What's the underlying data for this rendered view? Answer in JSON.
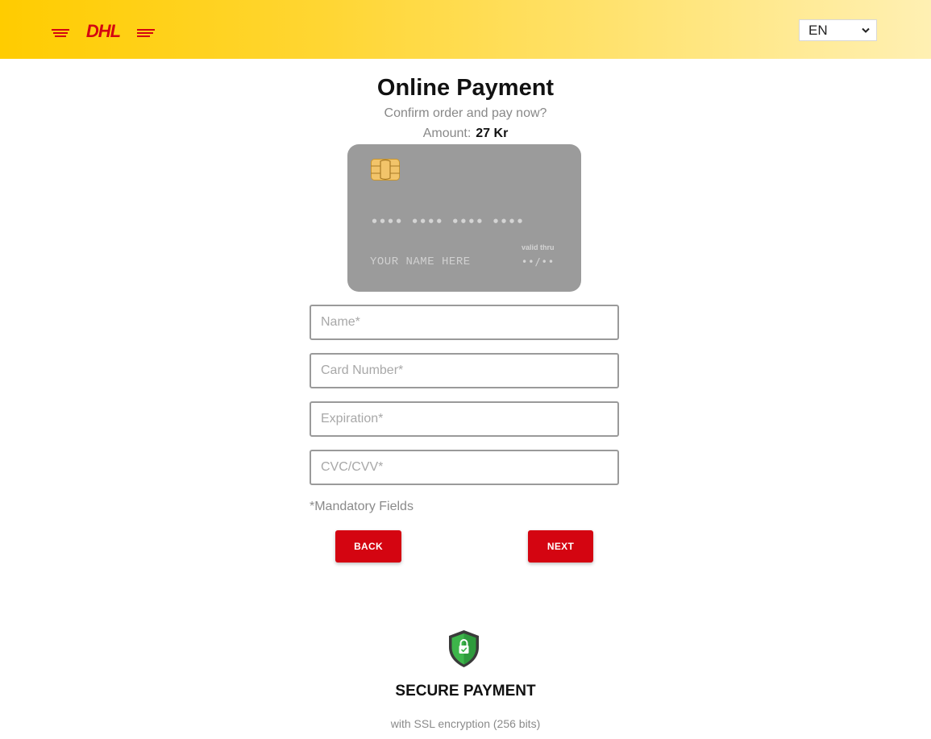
{
  "header": {
    "logo_text": "DHL",
    "language": {
      "selected": "EN"
    }
  },
  "main": {
    "title": "Online Payment",
    "subtitle": "Confirm order and pay now?",
    "amount_label": "Amount:",
    "amount_value": "27 Kr"
  },
  "card_preview": {
    "number_mask": "•••• •••• •••• ••••",
    "name_placeholder": "YOUR NAME HERE",
    "valid_thru_label": "valid thru",
    "expiry_mask": "••/••"
  },
  "form": {
    "name_placeholder": "Name*",
    "card_number_placeholder": "Card Number*",
    "expiration_placeholder": "Expiration*",
    "cvc_placeholder": "CVC/CVV*",
    "mandatory_note": "*Mandatory Fields",
    "back_label": "BACK",
    "next_label": "NEXT"
  },
  "security": {
    "title": "SECURE PAYMENT",
    "subtitle": "with SSL encryption (256 bits)"
  },
  "colors": {
    "brand_yellow": "#ffcc00",
    "brand_red": "#d40511",
    "card_grey": "#9b9b9b",
    "shield_green": "#3db54a"
  }
}
